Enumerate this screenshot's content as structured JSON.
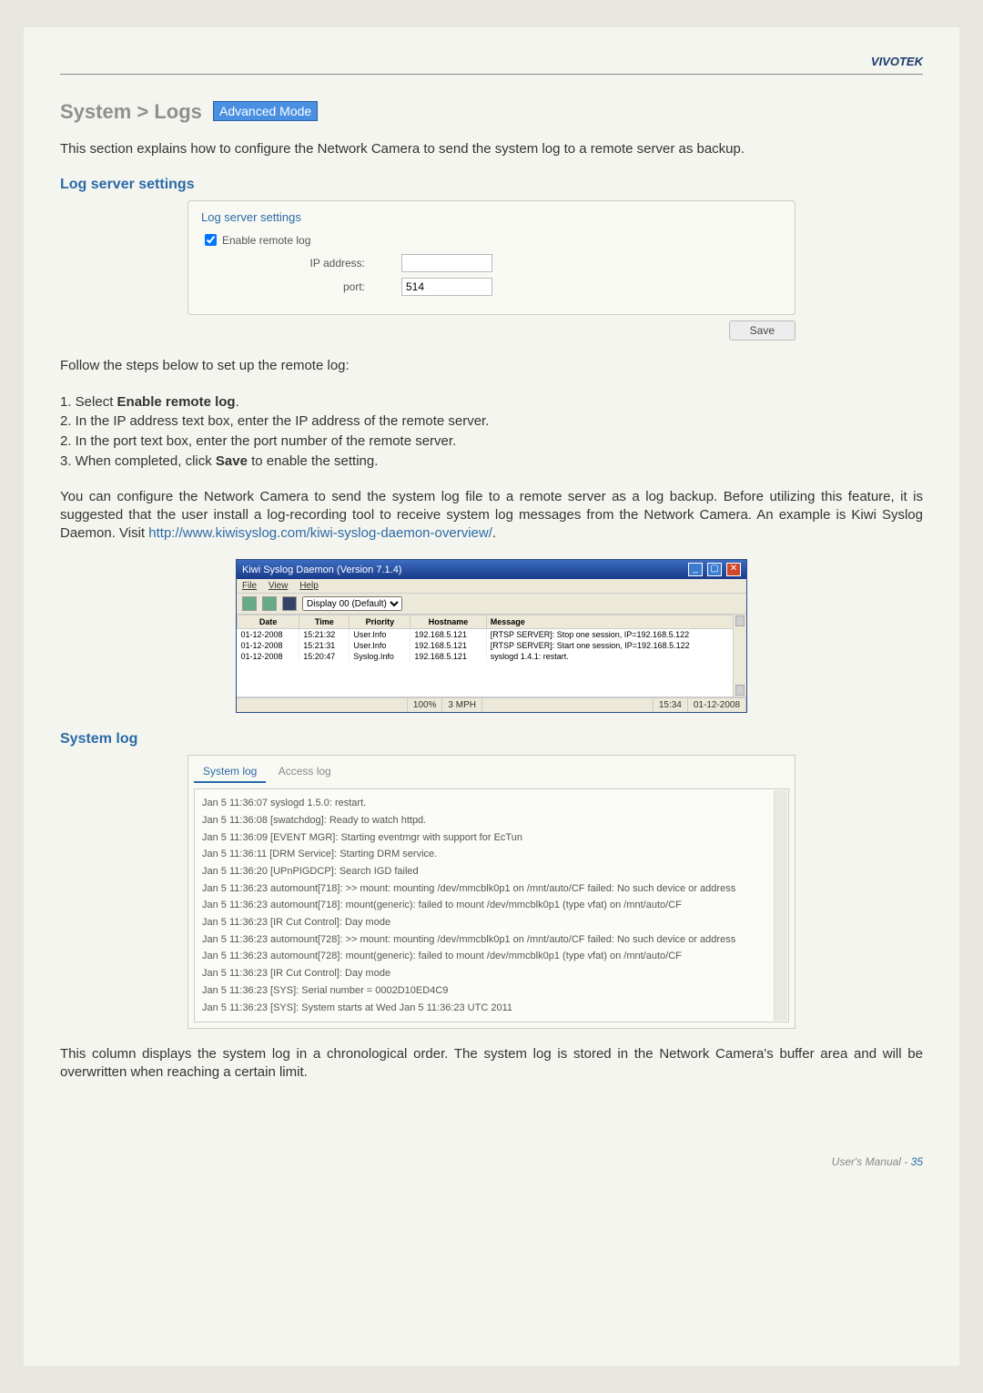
{
  "brand": "VIVOTEK",
  "title": {
    "prefix": "System > Logs",
    "badge": "Advanced Mode"
  },
  "intro": "This section explains how to configure the Network Camera to send the system log to a remote server as backup.",
  "log_server": {
    "heading": "Log server settings",
    "legend": "Log server settings",
    "enable_label": "Enable remote log",
    "ip_label": "IP address:",
    "ip_value": "",
    "port_label": "port:",
    "port_value": "514",
    "save_label": "Save"
  },
  "follow_intro": "Follow the steps below to set up the remote log:",
  "steps": {
    "s1a": "1. Select ",
    "s1b": "Enable remote log",
    "s1c": ".",
    "s2": "2. In the IP address text box, enter the IP address of the remote server.",
    "s3": "2. In the port text box, enter the port number of the remote server.",
    "s4a": "3. When completed, click ",
    "s4b": "Save",
    "s4c": " to enable the setting."
  },
  "para2a": "You can configure the Network Camera to send the system log file to a remote server as a log backup. Before utilizing this feature, it is suggested that the user install a log-recording tool to receive system log messages from the Network Camera. An example is Kiwi Syslog Daemon. Visit ",
  "para2b": "http://www.kiwisyslog.com/kiwi-syslog-daemon-overview/",
  "para2c": ".",
  "kiwi": {
    "title": "Kiwi Syslog Daemon (Version 7.1.4)",
    "menu": {
      "file": "File",
      "view": "View",
      "help": "Help"
    },
    "display": "Display 00 (Default)",
    "cols": {
      "date": "Date",
      "time": "Time",
      "priority": "Priority",
      "hostname": "Hostname",
      "message": "Message"
    },
    "rows": [
      {
        "date": "01-12-2008",
        "time": "15:21:32",
        "priority": "User.Info",
        "hostname": "192.168.5.121",
        "message": "[RTSP SERVER]: Stop one session, IP=192.168.5.122"
      },
      {
        "date": "01-12-2008",
        "time": "15:21:31",
        "priority": "User.Info",
        "hostname": "192.168.5.121",
        "message": "[RTSP SERVER]: Start one session, IP=192.168.5.122"
      },
      {
        "date": "01-12-2008",
        "time": "15:20:47",
        "priority": "Syslog.Info",
        "hostname": "192.168.5.121",
        "message": "syslogd 1.4.1: restart."
      }
    ],
    "status": {
      "pct": "100%",
      "rate": "3 MPH",
      "time": "15:34",
      "date": "01-12-2008"
    }
  },
  "system_log": {
    "heading": "System log",
    "tabs": {
      "system": "System log",
      "access": "Access log"
    },
    "lines": [
      "Jan 5 11:36:07 syslogd 1.5.0: restart.",
      "Jan 5 11:36:08 [swatchdog]: Ready to watch httpd.",
      "Jan 5 11:36:09 [EVENT MGR]: Starting eventmgr with support for EcTun",
      "Jan 5 11:36:11 [DRM Service]: Starting DRM service.",
      "Jan 5 11:36:20 [UPnPIGDCP]: Search IGD failed",
      "Jan 5 11:36:23 automount[718]: >> mount: mounting /dev/mmcblk0p1 on /mnt/auto/CF failed: No such device or address",
      "Jan 5 11:36:23 automount[718]: mount(generic): failed to mount /dev/mmcblk0p1 (type vfat) on /mnt/auto/CF",
      "Jan 5 11:36:23 [IR Cut Control]: Day mode",
      "Jan 5 11:36:23 automount[728]: >> mount: mounting /dev/mmcblk0p1 on /mnt/auto/CF failed: No such device or address",
      "Jan 5 11:36:23 automount[728]: mount(generic): failed to mount /dev/mmcblk0p1 (type vfat) on /mnt/auto/CF",
      "Jan 5 11:36:23 [IR Cut Control]: Day mode",
      "Jan 5 11:36:23 [SYS]: Serial number = 0002D10ED4C9",
      "Jan 5 11:36:23 [SYS]: System starts at Wed Jan 5 11:36:23 UTC 2011"
    ]
  },
  "closing": "This column displays the system log in a chronological order. The system log is stored in the Network Camera's buffer area and will be overwritten when reaching a certain limit.",
  "footer": {
    "label": "User's Manual - ",
    "page": "35"
  }
}
